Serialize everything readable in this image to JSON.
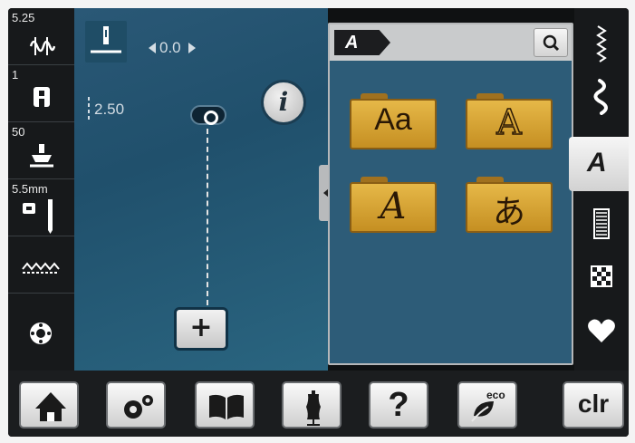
{
  "left_status": {
    "thread_tension": "5.25",
    "stitch_plate": "1",
    "presser_foot_pressure": "50",
    "needle": "5.5mm"
  },
  "work_area": {
    "stitch_width": "0.0",
    "stitch_length": "2.50",
    "info_label": "i",
    "add_label": "+"
  },
  "panel": {
    "mode_label": "A",
    "folders": [
      {
        "glyph": "Aa",
        "icon": "textbook-font-folder"
      },
      {
        "glyph": "A",
        "icon": "outline-font-folder"
      },
      {
        "glyph": "A",
        "icon": "script-font-folder"
      },
      {
        "glyph": "あ",
        "icon": "japanese-font-folder"
      }
    ]
  },
  "right_categories": {
    "active_label": "A",
    "items": [
      "practical-stitches-icon",
      "decorative-stitches-icon",
      "alphabets-icon",
      "buttonholes-icon",
      "quilt-stitches-icon",
      "personal-program-icon"
    ]
  },
  "bottom_bar": {
    "eco_label": "eco",
    "clear_label": "clr",
    "help_label": "?"
  },
  "colors": {
    "accent_blue": "#2d5c78",
    "folder_gold": "#d9a53a"
  }
}
